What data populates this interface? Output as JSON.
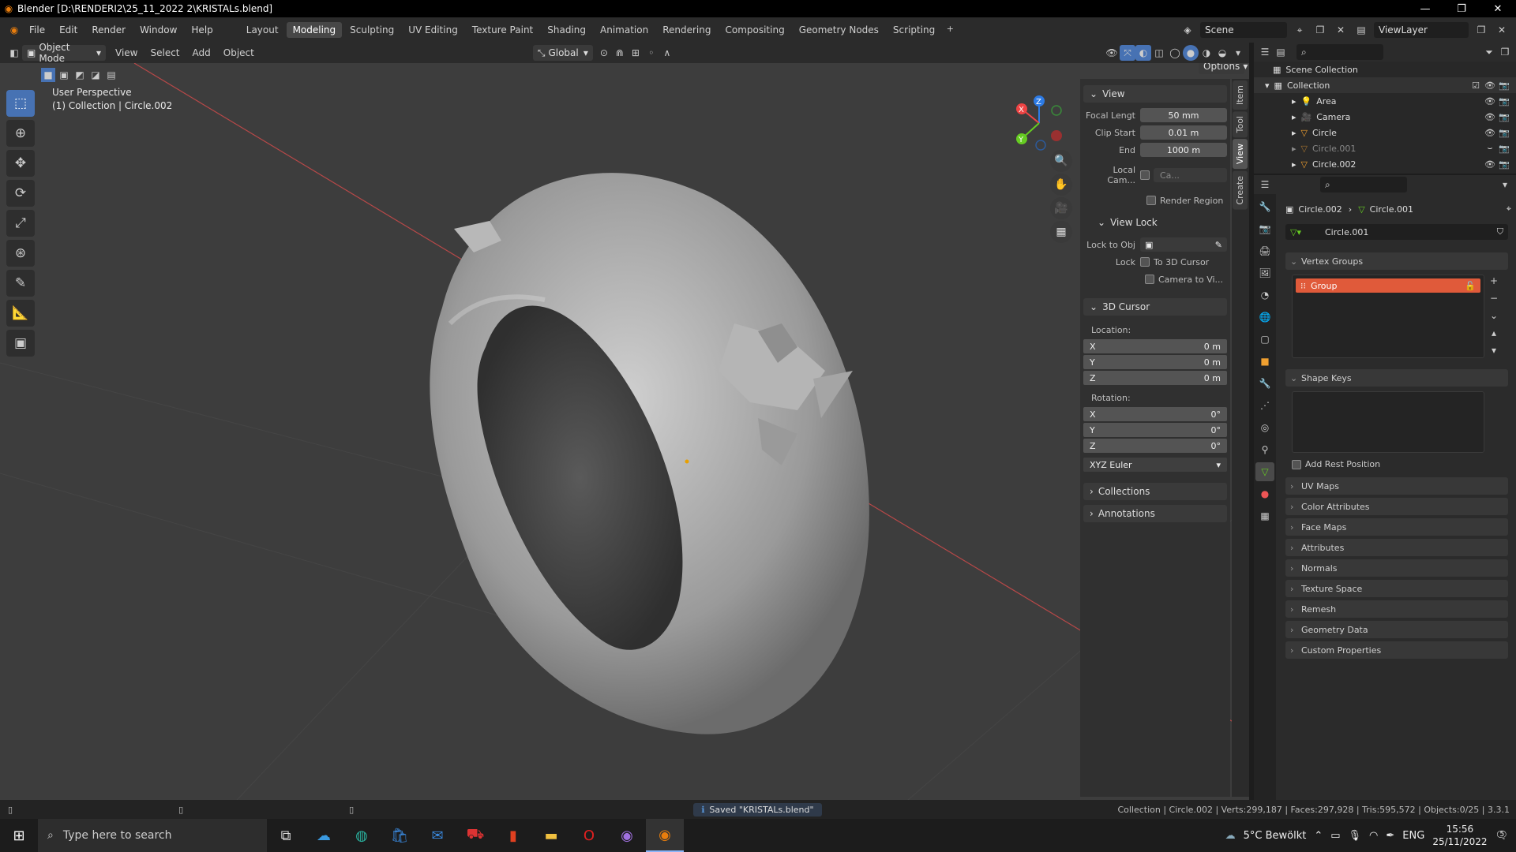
{
  "title_bar": {
    "text": "Blender [D:\\RENDERI2\\25_11_2022 2\\KRISTALs.blend]"
  },
  "menu": [
    "File",
    "Edit",
    "Render",
    "Window",
    "Help"
  ],
  "workspaces": [
    "Layout",
    "Modeling",
    "Sculpting",
    "UV Editing",
    "Texture Paint",
    "Shading",
    "Animation",
    "Rendering",
    "Compositing",
    "Geometry Nodes",
    "Scripting"
  ],
  "active_workspace": "Modeling",
  "scene": "Scene",
  "view_layer": "ViewLayer",
  "viewport_header": {
    "mode": "Object Mode",
    "menus": [
      "View",
      "Select",
      "Add",
      "Object"
    ],
    "orientation": "Global",
    "options": "Options"
  },
  "viewport": {
    "perspective": "User Perspective",
    "collection_info": "(1) Collection | Circle.002"
  },
  "gizmo": {
    "x": "X",
    "y": "Y",
    "z": "Z"
  },
  "npanel": {
    "view_header": "View",
    "focal_label": "Focal Lengt",
    "focal_value": "50 mm",
    "clip_start_label": "Clip Start",
    "clip_start_value": "0.01 m",
    "clip_end_label": "End",
    "clip_end_value": "1000 m",
    "local_cam_label": "Local Cam...",
    "local_cam_value": "Ca...",
    "render_region": "Render Region",
    "view_lock_header": "View Lock",
    "lock_to_obj": "Lock to Obj",
    "lock_label": "Lock",
    "to_3d_cursor": "To 3D Cursor",
    "camera_to_view": "Camera to Vi...",
    "cursor_header": "3D Cursor",
    "location_label": "Location:",
    "loc": {
      "x": "0 m",
      "y": "0 m",
      "z": "0 m"
    },
    "rotation_label": "Rotation:",
    "rot": {
      "x": "0°",
      "y": "0°",
      "z": "0°"
    },
    "euler": "XYZ Euler",
    "collections": "Collections",
    "annotations": "Annotations",
    "tabs": [
      "Item",
      "Tool",
      "View",
      "Create"
    ]
  },
  "outliner": {
    "root": "Scene Collection",
    "collection": "Collection",
    "items": [
      "Area",
      "Camera",
      "Circle",
      "Circle.001",
      "Circle.002"
    ]
  },
  "properties": {
    "breadcrumb_a": "Circle.002",
    "breadcrumb_b": "Circle.001",
    "data_name": "Circle.001",
    "vertex_groups": "Vertex Groups",
    "group": "Group",
    "shape_keys": "Shape Keys",
    "add_rest_position": "Add Rest Position",
    "sections": [
      "UV Maps",
      "Color Attributes",
      "Face Maps",
      "Attributes",
      "Normals",
      "Texture Space",
      "Remesh",
      "Geometry Data",
      "Custom Properties"
    ]
  },
  "status": {
    "saved": "Saved \"KRISTALs.blend\"",
    "stats": "Collection | Circle.002 | Verts:299,187 | Faces:297,928 | Tris:595,572 | Objects:0/25 | 3.3.1"
  },
  "taskbar": {
    "search_placeholder": "Type here to search",
    "weather": "5°C  Bewölkt",
    "lang": "ENG",
    "time": "15:56",
    "date": "25/11/2022",
    "notifications": "5"
  }
}
